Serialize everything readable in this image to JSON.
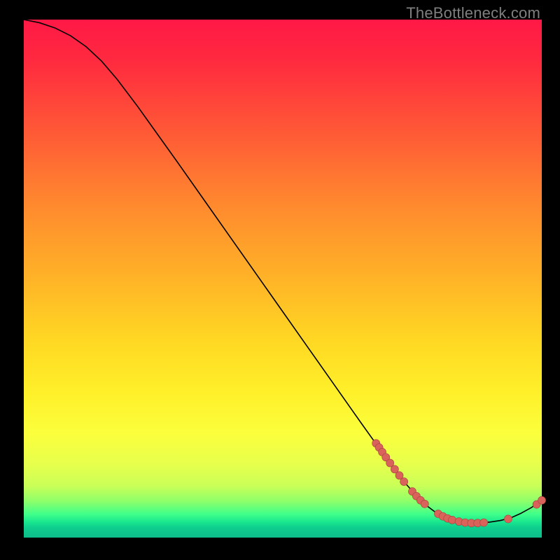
{
  "watermark": "TheBottleneck.com",
  "colors": {
    "background": "#000000",
    "curve": "#000000",
    "marker_fill": "#d9635b",
    "marker_stroke": "#a5433c",
    "gradient_top": "#ff1846",
    "gradient_mid": "#ffe02a",
    "gradient_bottom": "#0dbd8b"
  },
  "chart_data": {
    "type": "line",
    "title": "",
    "xlabel": "",
    "ylabel": "",
    "xlim": [
      0,
      100
    ],
    "ylim": [
      0,
      100
    ],
    "grid": false,
    "curve": [
      {
        "x": 0,
        "y": 100.0
      },
      {
        "x": 3,
        "y": 99.4
      },
      {
        "x": 6,
        "y": 98.4
      },
      {
        "x": 9,
        "y": 96.9
      },
      {
        "x": 12,
        "y": 94.8
      },
      {
        "x": 15,
        "y": 92.0
      },
      {
        "x": 18,
        "y": 88.5
      },
      {
        "x": 22,
        "y": 83.2
      },
      {
        "x": 26,
        "y": 77.6
      },
      {
        "x": 30,
        "y": 72.0
      },
      {
        "x": 35,
        "y": 64.9
      },
      {
        "x": 40,
        "y": 57.8
      },
      {
        "x": 45,
        "y": 50.7
      },
      {
        "x": 50,
        "y": 43.6
      },
      {
        "x": 55,
        "y": 36.5
      },
      {
        "x": 60,
        "y": 29.4
      },
      {
        "x": 65,
        "y": 22.3
      },
      {
        "x": 68,
        "y": 18.1
      },
      {
        "x": 70,
        "y": 15.3
      },
      {
        "x": 72,
        "y": 12.6
      },
      {
        "x": 74,
        "y": 10.1
      },
      {
        "x": 75,
        "y": 9.0
      },
      {
        "x": 76,
        "y": 7.9
      },
      {
        "x": 78,
        "y": 6.0
      },
      {
        "x": 80,
        "y": 4.5
      },
      {
        "x": 82,
        "y": 3.5
      },
      {
        "x": 84,
        "y": 3.0
      },
      {
        "x": 86,
        "y": 2.8
      },
      {
        "x": 88,
        "y": 2.8
      },
      {
        "x": 90,
        "y": 3.0
      },
      {
        "x": 92,
        "y": 3.3
      },
      {
        "x": 94,
        "y": 3.8
      },
      {
        "x": 96,
        "y": 4.7
      },
      {
        "x": 98,
        "y": 5.8
      },
      {
        "x": 99,
        "y": 6.5
      },
      {
        "x": 100,
        "y": 7.2
      }
    ],
    "markers": [
      {
        "x": 68.0,
        "y": 18.2
      },
      {
        "x": 68.6,
        "y": 17.4
      },
      {
        "x": 69.2,
        "y": 16.5
      },
      {
        "x": 69.9,
        "y": 15.5
      },
      {
        "x": 70.7,
        "y": 14.4
      },
      {
        "x": 71.6,
        "y": 13.2
      },
      {
        "x": 72.5,
        "y": 12.0
      },
      {
        "x": 73.4,
        "y": 10.8
      },
      {
        "x": 75.0,
        "y": 8.9
      },
      {
        "x": 75.8,
        "y": 8.0
      },
      {
        "x": 76.6,
        "y": 7.2
      },
      {
        "x": 77.4,
        "y": 6.5
      },
      {
        "x": 80.0,
        "y": 4.6
      },
      {
        "x": 80.9,
        "y": 4.1
      },
      {
        "x": 81.8,
        "y": 3.7
      },
      {
        "x": 82.7,
        "y": 3.4
      },
      {
        "x": 84.0,
        "y": 3.1
      },
      {
        "x": 85.2,
        "y": 2.9
      },
      {
        "x": 86.4,
        "y": 2.8
      },
      {
        "x": 87.6,
        "y": 2.8
      },
      {
        "x": 88.8,
        "y": 2.9
      },
      {
        "x": 93.5,
        "y": 3.6
      },
      {
        "x": 99.0,
        "y": 6.4
      },
      {
        "x": 100.0,
        "y": 7.2
      }
    ]
  }
}
